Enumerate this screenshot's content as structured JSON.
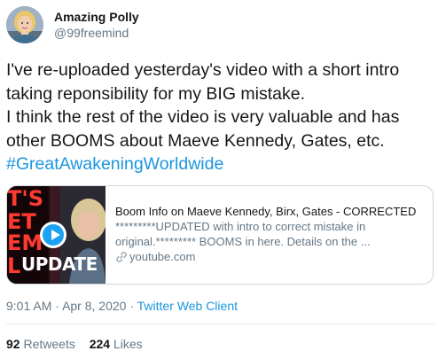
{
  "author": {
    "name": "Amazing Polly",
    "handle": "@99freemind"
  },
  "tweet": {
    "lines": [
      "I've re-uploaded yesterday's video with a short intro",
      "taking reponsibility for my BIG mistake.",
      "I think the rest of the video is very valuable and has",
      "other BOOMS about Maeve Kennedy, Gates, etc."
    ],
    "hashtag": "#GreatAwakeningWorldwide"
  },
  "card": {
    "title": "Boom Info on Maeve Kennedy, Birx, Gates - CORRECTED",
    "description_lines": [
      "*********UPDATED with intro to correct mistake in",
      "original.********* BOOMS in here. Details on the ..."
    ],
    "domain": "youtube.com",
    "thumbnail": {
      "text_lines": [
        "T'S",
        "ET",
        "EM",
        "L"
      ],
      "update_label": "UPDATE"
    }
  },
  "meta": {
    "time": "9:01 AM",
    "separator": "·",
    "date": "Apr 8, 2020",
    "source": "Twitter Web Client"
  },
  "stats": {
    "retweets_count": "92",
    "retweets_label": "Retweets",
    "likes_count": "224",
    "likes_label": "Likes"
  },
  "colors": {
    "link": "#1b95e0",
    "secondary_text": "#657786",
    "play_button": "#1da1f2"
  }
}
